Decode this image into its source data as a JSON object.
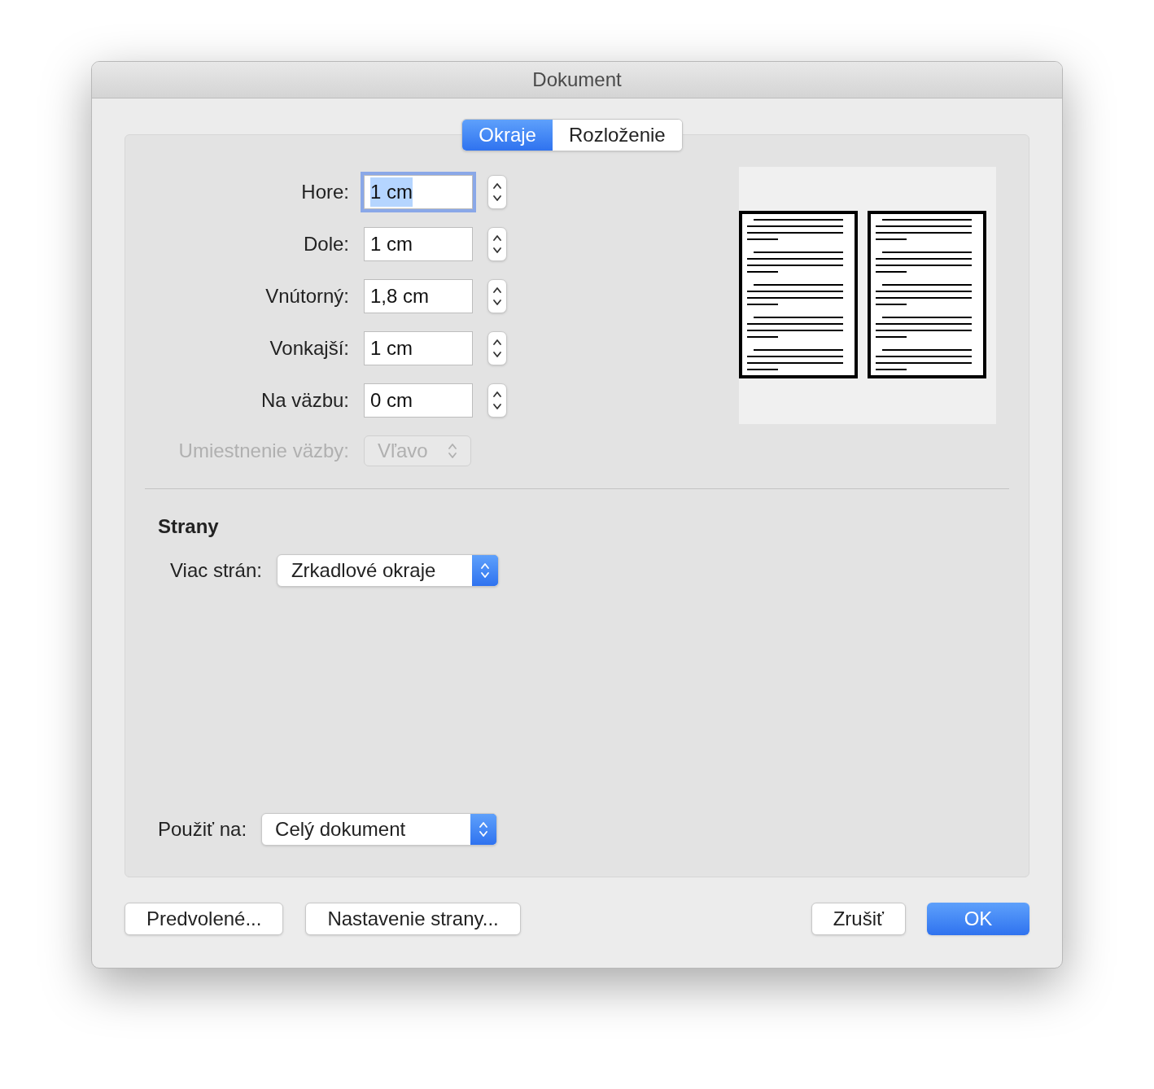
{
  "window": {
    "title": "Dokument"
  },
  "tabs": [
    {
      "label": "Okraje",
      "selected": true
    },
    {
      "label": "Rozloženie",
      "selected": false
    }
  ],
  "margins": [
    {
      "label": "Hore:",
      "value": "1 cm",
      "focused": true
    },
    {
      "label": "Dole:",
      "value": "1 cm",
      "focused": false
    },
    {
      "label": "Vnútorný:",
      "value": "1,8 cm",
      "focused": false
    },
    {
      "label": "Vonkajší:",
      "value": "1 cm",
      "focused": false
    },
    {
      "label": "Na väzbu:",
      "value": "0 cm",
      "focused": false
    }
  ],
  "gutter_position": {
    "label": "Umiestnenie väzby:",
    "value": "Vľavo",
    "disabled": true
  },
  "pages": {
    "heading": "Strany",
    "label": "Viac strán:",
    "value": "Zrkadlové okraje"
  },
  "apply_to": {
    "label": "Použiť na:",
    "value": "Celý dokument"
  },
  "buttons": [
    {
      "label": "Predvolené...",
      "kind": "plain"
    },
    {
      "label": "Nastavenie strany...",
      "kind": "plain"
    },
    {
      "label": "Zrušiť",
      "kind": "plain"
    },
    {
      "label": "OK",
      "kind": "default"
    }
  ]
}
